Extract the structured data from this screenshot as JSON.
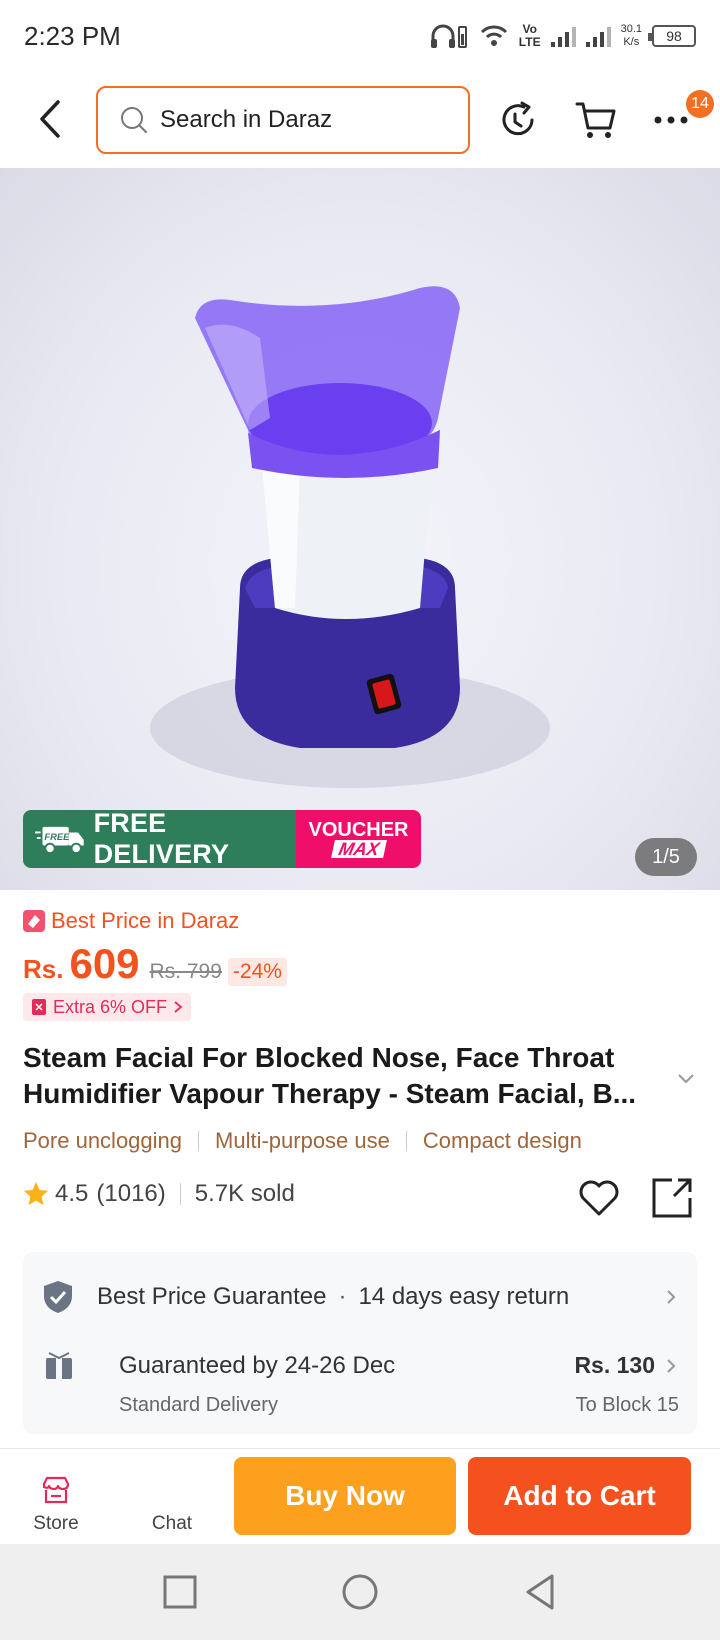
{
  "status_bar": {
    "time": "2:23 PM",
    "net_type_top": "Vo",
    "net_type_bottom": "LTE",
    "speed_top": "30.1",
    "speed_bottom": "K/s",
    "battery": "98"
  },
  "header": {
    "search_placeholder": "Search in Daraz",
    "menu_badge": "14"
  },
  "product": {
    "image_counter": "1/5",
    "promo": {
      "free_tag": "FREE",
      "free_delivery": "FREE DELIVERY",
      "voucher_line1": "VOUCHER",
      "voucher_line2": "MAX"
    },
    "best_price_label": "Best Price in Daraz",
    "currency": "Rs.",
    "price": "609",
    "original_price": "Rs. 799",
    "discount": "-24%",
    "extra_off": "Extra 6% OFF",
    "title_line1": "Steam Facial For Blocked Nose, Face Throat",
    "title_line2": "Humidifier Vapour Therapy - Steam Facial, B...",
    "features": [
      "Pore unclogging",
      "Multi-purpose use",
      "Compact design"
    ],
    "rating": "4.5",
    "reviews": "(1016)",
    "sold": "5.7K sold"
  },
  "service": {
    "guarantee": "Best Price Guarantee",
    "returns": "14 days easy return",
    "delivery_title": "Guaranteed by 24-26 Dec",
    "delivery_type": "Standard Delivery",
    "delivery_price": "Rs. 130",
    "delivery_location": "To Block 15"
  },
  "bottom_bar": {
    "store_label": "Store",
    "chat_label": "Chat",
    "buy_now": "Buy Now",
    "add_to_cart": "Add to Cart"
  },
  "colors": {
    "brand_orange": "#f4511e",
    "buy_now": "#fca01e",
    "free_delivery_green": "#2e7d5b",
    "voucher_pink": "#ef0f6a"
  }
}
